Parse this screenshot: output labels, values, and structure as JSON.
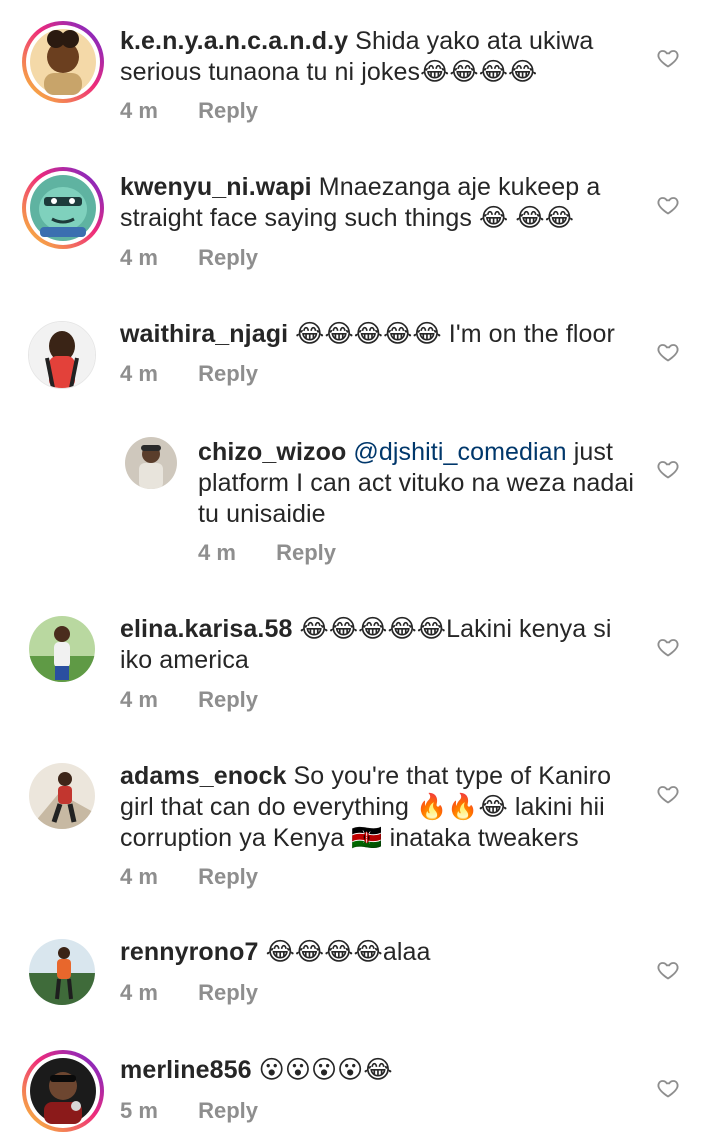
{
  "comments": [
    {
      "username": "k.e.n.y.a.n.c.a.n.d.y",
      "mention": "",
      "text": " Shida yako ata ukiwa serious tunaona tu ni jokes😂😂😂😂",
      "time": "4 m",
      "reply": "Reply"
    },
    {
      "username": "kwenyu_ni.wapi",
      "mention": "",
      "text": " Mnaezanga aje kukeep a straight face saying such things 😂 😂😂",
      "time": "4 m",
      "reply": "Reply"
    },
    {
      "username": "waithira_njagi",
      "mention": "",
      "text": " 😂😂😂😂😂 I'm on the floor",
      "time": "4 m",
      "reply": "Reply"
    },
    {
      "username": "chizo_wizoo",
      "mention": "@djshiti_comedian",
      "text": " just platform I can act vituko na weza nadai tu unisaidie",
      "time": "4 m",
      "reply": "Reply"
    },
    {
      "username": "elina.karisa.58",
      "mention": "",
      "text": " 😂😂😂😂😂Lakini kenya si iko america",
      "time": "4 m",
      "reply": "Reply"
    },
    {
      "username": "adams_enock",
      "mention": "",
      "text": " So you're that type of Kaniro girl that can do everything 🔥🔥😂 lakini hii corruption ya Kenya 🇰🇪 inataka tweakers",
      "time": "4 m",
      "reply": "Reply"
    },
    {
      "username": "rennyrono7",
      "mention": "",
      "text": " 😂😂😂😂alaa",
      "time": "4 m",
      "reply": "Reply"
    },
    {
      "username": "merline856",
      "mention": "",
      "text": " 😮😮😮😮😂",
      "time": "5 m",
      "reply": "Reply"
    }
  ],
  "colors": {
    "username": "#262626",
    "meta": "#8e8e8e",
    "mention": "#00376b",
    "heart": "#8e8e8e"
  }
}
